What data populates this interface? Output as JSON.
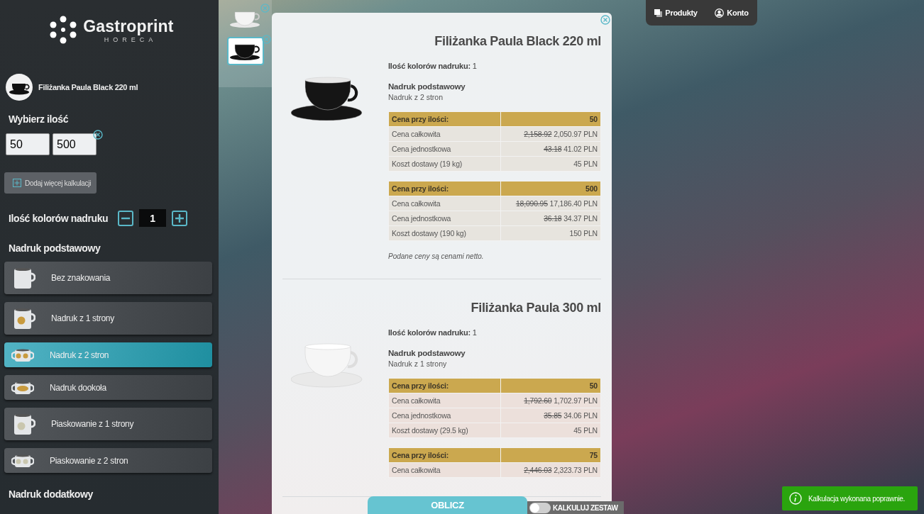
{
  "logo": {
    "name": "Gastroprint",
    "tagline": "HORECA"
  },
  "thumbnails": [
    {
      "kind": "white-cup",
      "selected": false
    },
    {
      "kind": "black-cup",
      "selected": true
    }
  ],
  "sidebar": {
    "product": {
      "name": "Filiżanka Paula Black 220 ml",
      "kind": "black-cup"
    },
    "quantity_label": "Wybierz ilość",
    "quantities": [
      {
        "value": "50",
        "removable": false
      },
      {
        "value": "500",
        "removable": true
      }
    ],
    "add_button": "Dodaj więcej kalkulacji",
    "colors": {
      "label": "Ilość kolorów nadruku",
      "value": "1"
    },
    "sections": [
      {
        "title": "Nadruk podstawowy",
        "options": [
          {
            "label": "Bez znakowania",
            "kind": "plain",
            "selected": false
          },
          {
            "label": "Nadruk z 1 strony",
            "kind": "print-one",
            "selected": false
          },
          {
            "label": "Nadruk z 2 stron",
            "kind": "print-two",
            "selected": true
          },
          {
            "label": "Nadruk dookoła",
            "kind": "print-around",
            "selected": false
          },
          {
            "label": "Piaskowanie z 1 strony",
            "kind": "sand-one",
            "selected": false
          },
          {
            "label": "Piaskowanie z 2 stron",
            "kind": "sand-two",
            "selected": false
          }
        ]
      },
      {
        "title": "Nadruk dodatkowy"
      }
    ]
  },
  "products": [
    {
      "name": "Filiżanka Paula Black 220 ml",
      "kind": "black-cup",
      "colors": "**Ilość kolorów nadruku:** 1",
      "print_title": "Nadruk podstawowy",
      "print_value": "Nadruk z 2 stron",
      "tables": [
        {
          "header": "Cena przy ilości:",
          "quantity": "50",
          "rows": [
            {
              "label": "Cena całkowita",
              "old": "2,158.92",
              "price": "2,050.97 PLN"
            },
            {
              "label": "Cena jednostkowa",
              "old": "43.18",
              "price": "41.02 PLN"
            },
            {
              "label": "Koszt dostawy (19 kg)",
              "price": "45 PLN"
            }
          ]
        },
        {
          "header": "Cena przy ilości:",
          "quantity": "500",
          "rows": [
            {
              "label": "Cena całkowita",
              "old": "18,090.95",
              "price": "17,186.40 PLN"
            },
            {
              "label": "Cena jednostkowa",
              "old": "36.18",
              "price": "34.37 PLN"
            },
            {
              "label": "Koszt dostawy (190 kg)",
              "price": "150 PLN"
            }
          ]
        }
      ],
      "note": "Podane ceny są cenami netto."
    },
    {
      "name": "Filiżanka Paula 300 ml",
      "kind": "white-cup",
      "colors": "**Ilość kolorów nadruku:** 1",
      "print_title": "Nadruk podstawowy",
      "print_value": "Nadruk z 1 strony",
      "tables": [
        {
          "header": "Cena przy ilości:",
          "quantity": "50",
          "rows": [
            {
              "label": "Cena całkowita",
              "old": "1,792.60",
              "price": "1,702.97 PLN"
            },
            {
              "label": "Cena jednostkowa",
              "old": "35.85",
              "price": "34.06 PLN"
            },
            {
              "label": "Koszt dostawy (29.5 kg)",
              "price": "45 PLN"
            }
          ]
        },
        {
          "header": "Cena przy ilości:",
          "quantity": "75",
          "rows": [
            {
              "label": "Cena całkowita",
              "old": "2,446.03",
              "price": "2,323.73 PLN"
            }
          ]
        }
      ]
    }
  ],
  "nav": [
    {
      "label": "Produkty",
      "kind": "products"
    },
    {
      "label": "Konto",
      "kind": "account"
    }
  ],
  "calculate_button": "OBLICZ",
  "set_toggle": {
    "label": "KALKULUJ ZESTAW",
    "on": false
  },
  "toast": "Kalkulacja wykonana poprawnie."
}
